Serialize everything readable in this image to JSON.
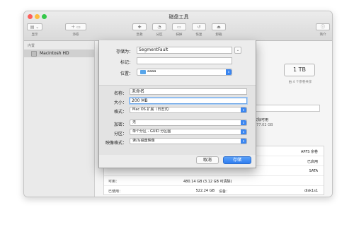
{
  "window": {
    "title": "磁盘工具"
  },
  "toolbar": {
    "show_label": "显示",
    "add_label": "添卷",
    "rescue_label": "急救",
    "partition_label": "分区",
    "erase_label": "抹掉",
    "restore_label": "恢复",
    "unmount_label": "卸载",
    "info_label": "简介"
  },
  "sidebar": {
    "section": "内置",
    "items": [
      {
        "label": "Macintosh HD"
      }
    ]
  },
  "overview": {
    "capacity": "1 TB",
    "capacity_note": "由 4 个宗卷共享",
    "available_label": "实际可用",
    "available_value": "477.02 GB"
  },
  "info_table": {
    "rows": [
      {
        "left_key": "",
        "left_value": "",
        "right_key": "",
        "right_value": "APFS 宗卷"
      },
      {
        "left_key": "",
        "left_value": "",
        "right_key": "",
        "right_value": "已启用"
      },
      {
        "left_key": "",
        "left_value": "",
        "right_key": "",
        "right_value": "SATA"
      },
      {
        "left_key": "可用：",
        "left_value": "480.14 GB (3.12 GB 可清除)",
        "right_key": "",
        "right_value": ""
      },
      {
        "left_key": "已使用：",
        "left_value": "522.24 GB",
        "right_key": "设备：",
        "right_value": "disk1s1"
      }
    ]
  },
  "save_sheet": {
    "save_as_label": "存储为：",
    "save_as_value": "SegmentFault",
    "tags_label": "标记：",
    "tags_value": "",
    "location_label": "位置：",
    "location_value": "aaaa",
    "name_label": "名称：",
    "name_value": "未命名",
    "size_label": "大小：",
    "size_value": "200 MB",
    "format_label": "格式：",
    "format_value": "Mac OS 扩展（日志式）",
    "encryption_label": "加密：",
    "encryption_value": "无",
    "partition_label": "分区：",
    "partition_value": "单个分区 - GUID 分区图",
    "image_format_label": "映像格式：",
    "image_format_value": "读/写磁盘映像",
    "cancel_label": "取消",
    "save_label": "存储"
  },
  "colors": {
    "accent": "#3b86f0",
    "folder": "#57a5ea"
  }
}
